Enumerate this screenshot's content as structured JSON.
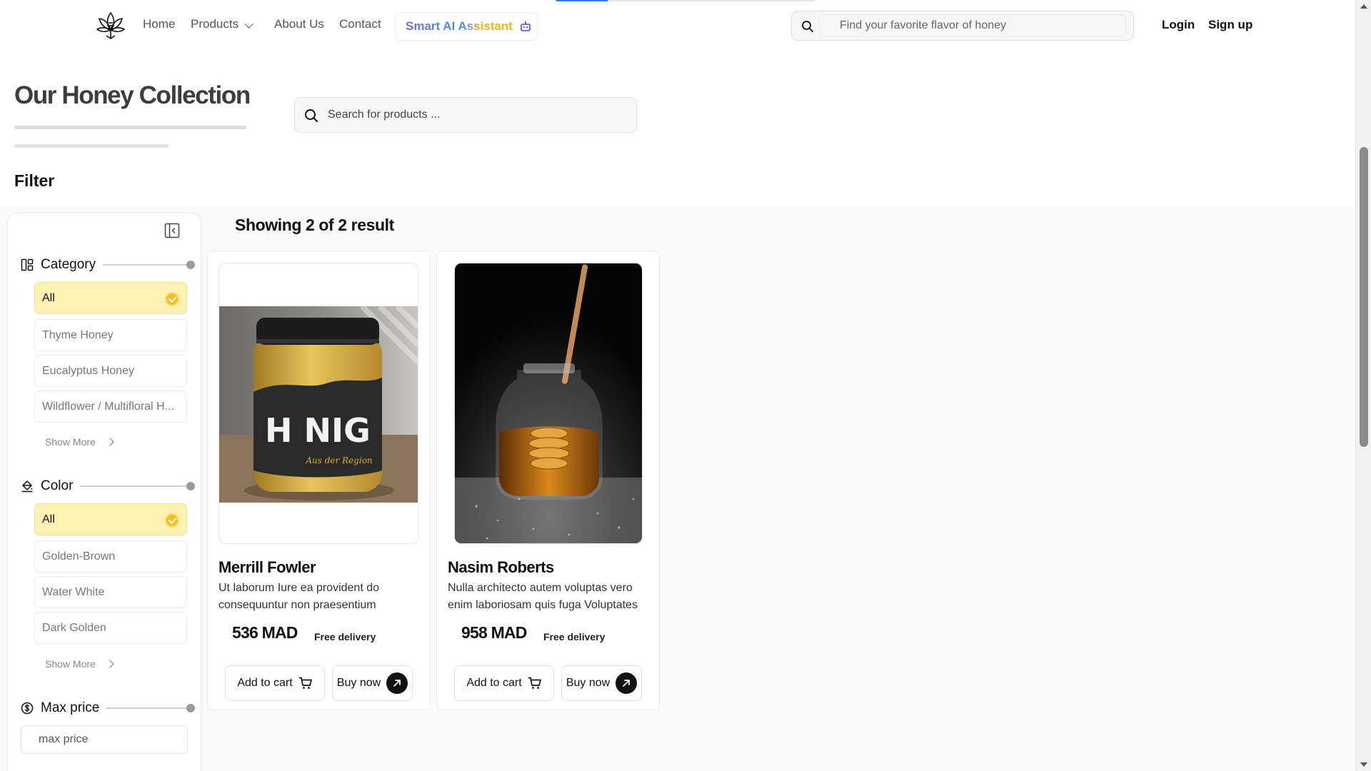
{
  "nav": {
    "links": {
      "home": "Home",
      "products": "Products",
      "about": "About Us",
      "contact": "Contact"
    },
    "ai_button": "Smart AI Assistant",
    "search_placeholder": "Find your favorite flavor of honey",
    "login": "Login",
    "signup": "Sign up",
    "scroll_progress": 0.2
  },
  "header": {
    "title": "Our Honey Collection",
    "search_placeholder": "Search for products ...",
    "filter_heading": "Filter"
  },
  "filters": {
    "category": {
      "label": "Category",
      "options": [
        "All",
        "Thyme Honey",
        "Eucalyptus Honey",
        "Wildflower / Multifloral H..."
      ],
      "selected": "All",
      "show_more": "Show More"
    },
    "color": {
      "label": "Color",
      "options": [
        "All",
        "Golden-Brown",
        "Water White",
        "Dark Golden"
      ],
      "selected": "All",
      "show_more": "Show More"
    },
    "max_price": {
      "label": "Max price",
      "placeholder": "max price"
    }
  },
  "results": {
    "heading": "Showing 2 of 2 result",
    "products": [
      {
        "name": "Merrill Fowler",
        "description": "Ut laborum Iure ea provident do consequuntur non praesentium",
        "price": "536 MAD",
        "delivery": "Free delivery",
        "add_to_cart": "Add to cart",
        "buy_now": "Buy now",
        "jar_label": "H NIG",
        "jar_sublabel": "Aus der Region"
      },
      {
        "name": "Nasim Roberts",
        "description": "Nulla architecto autem voluptas vero enim laboriosam quis fuga Voluptates",
        "price": "958 MAD",
        "delivery": "Free delivery",
        "add_to_cart": "Add to cart",
        "buy_now": "Buy now"
      }
    ]
  },
  "colors": {
    "accent_yellow": "#f2c11b",
    "selected_bg": "#fdf1b3",
    "ai_gradient_blue": "#4a8fe0",
    "ai_gradient_gold": "#f0b323",
    "progress_blue": "#2f7de1"
  },
  "icons": {
    "logo": "lotus-logo-icon",
    "ai": "robot-icon",
    "search": "search-icon",
    "collapse": "sidebar-collapse-icon",
    "category": "layout-grid-icon",
    "color": "paint-bucket-icon",
    "price": "dollar-circle-icon",
    "cart": "cart-icon",
    "buy": "arrow-up-right-icon"
  }
}
